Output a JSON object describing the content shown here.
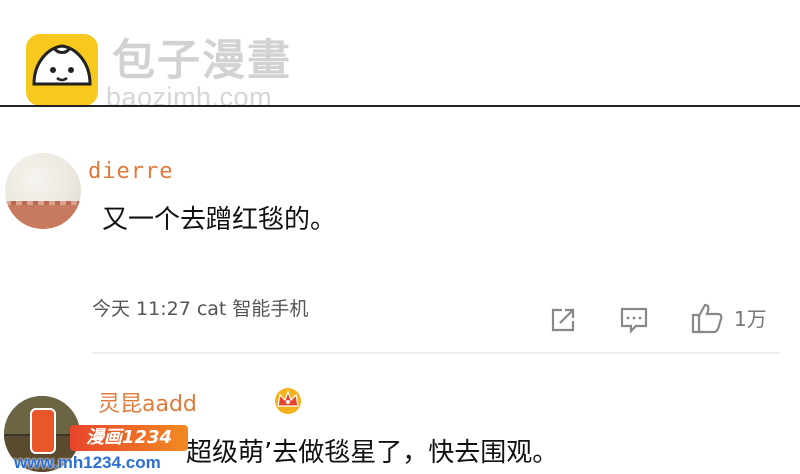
{
  "brand": {
    "title": "包子漫畫",
    "url": "baozimh.com",
    "logo_icon": "bun-face-icon",
    "logo_color": "#f7c81e"
  },
  "comments": [
    {
      "username": "dierre",
      "username_color": "#e07a3a",
      "avatar": "avatar-beige",
      "text": "又一个去蹭红毯的。",
      "meta": "今天 11:27 cat 智能手机",
      "actions": {
        "share_icon": "share-icon",
        "reply_icon": "comment-icon",
        "like_icon": "thumbs-up-icon",
        "like_count": "1万"
      }
    },
    {
      "username": "灵昆aadd",
      "badge_icon": "crown-icon",
      "avatar": "avatar-photo",
      "text": "超级萌’去做毯星了，快去围观。"
    }
  ],
  "watermark": {
    "label": "漫画1234",
    "url": "www.mh1234.com"
  }
}
